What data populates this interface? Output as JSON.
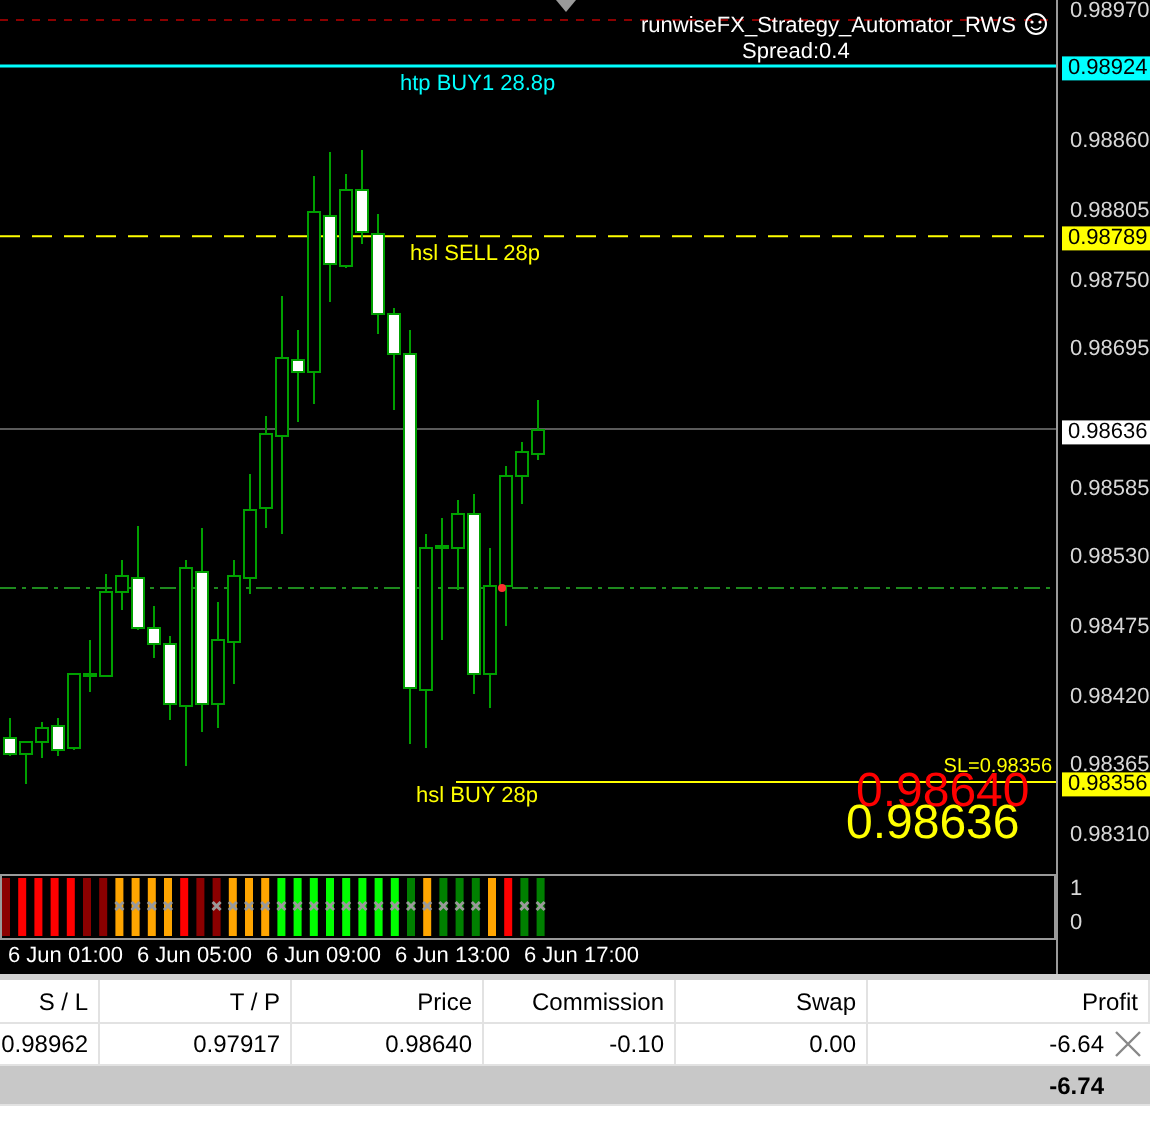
{
  "chart": {
    "title": "runwiseFX_Strategy_Automator_RWS",
    "spread": "Spread:0.4",
    "level_lines": [
      {
        "kind": "take-profit",
        "label": "htp BUY1 28.8p",
        "tag": "0.98924",
        "color": "#00ffff"
      },
      {
        "kind": "sell-stop",
        "label": "hsl SELL 28p",
        "tag": "0.98789",
        "color": "#ffff00"
      },
      {
        "kind": "bid",
        "tag": "0.98636",
        "color": "#ffffff"
      },
      {
        "kind": "buy-stop",
        "label": "hsl BUY 28p",
        "note": "SL=0.98356",
        "tag": "0.98356",
        "color": "#ffff00"
      }
    ],
    "big_prices": [
      {
        "text": "0.98640",
        "color": "#ff0000"
      },
      {
        "text": "0.98636",
        "color": "#ffff00"
      }
    ],
    "price_axis": [
      "0.98970",
      "0.98860",
      "0.98805",
      "0.98750",
      "0.98695",
      "0.98585",
      "0.98530",
      "0.98475",
      "0.98420",
      "0.98365",
      "0.98310"
    ],
    "indicator": {
      "axis": [
        "1",
        "0"
      ],
      "bars": [
        {
          "color": "#8b0000",
          "crossed": false
        },
        {
          "color": "#ff0000",
          "crossed": false
        },
        {
          "color": "#ff0000",
          "crossed": false
        },
        {
          "color": "#ff0000",
          "crossed": false
        },
        {
          "color": "#ff0000",
          "crossed": false
        },
        {
          "color": "#8b0000",
          "crossed": false
        },
        {
          "color": "#8b0000",
          "crossed": false
        },
        {
          "color": "#ffa500",
          "crossed": true
        },
        {
          "color": "#ffa500",
          "crossed": true
        },
        {
          "color": "#ffa500",
          "crossed": true
        },
        {
          "color": "#ffa500",
          "crossed": true
        },
        {
          "color": "#ff0000",
          "crossed": false
        },
        {
          "color": "#8b0000",
          "crossed": false
        },
        {
          "color": "#8b0000",
          "crossed": true
        },
        {
          "color": "#ffa500",
          "crossed": true
        },
        {
          "color": "#ffa500",
          "crossed": true
        },
        {
          "color": "#ffa500",
          "crossed": true
        },
        {
          "color": "#00ff00",
          "crossed": true
        },
        {
          "color": "#00ff00",
          "crossed": true
        },
        {
          "color": "#00ff00",
          "crossed": true
        },
        {
          "color": "#00ff00",
          "crossed": true
        },
        {
          "color": "#00ff00",
          "crossed": true
        },
        {
          "color": "#00ff00",
          "crossed": true
        },
        {
          "color": "#00ff00",
          "crossed": true
        },
        {
          "color": "#00ff00",
          "crossed": true
        },
        {
          "color": "#008000",
          "crossed": true
        },
        {
          "color": "#ffa500",
          "crossed": true
        },
        {
          "color": "#008000",
          "crossed": true
        },
        {
          "color": "#008000",
          "crossed": true
        },
        {
          "color": "#008000",
          "crossed": true
        },
        {
          "color": "#ffa500",
          "crossed": false
        },
        {
          "color": "#ff0000",
          "crossed": false
        },
        {
          "color": "#008000",
          "crossed": true
        },
        {
          "color": "#008000",
          "crossed": true
        }
      ]
    },
    "time_axis": [
      "6 Jun 01:00",
      "6 Jun 05:00",
      "6 Jun 09:00",
      "6 Jun 13:00",
      "6 Jun 17:00"
    ]
  },
  "table": {
    "columns": [
      "S / L",
      "T / P",
      "Price",
      "Commission",
      "Swap",
      "Profit"
    ],
    "rows": [
      {
        "cells": [
          "0.98962",
          "0.97917",
          "0.98640",
          "-0.10",
          "0.00",
          "-6.64"
        ]
      }
    ],
    "total": "-6.74"
  }
}
